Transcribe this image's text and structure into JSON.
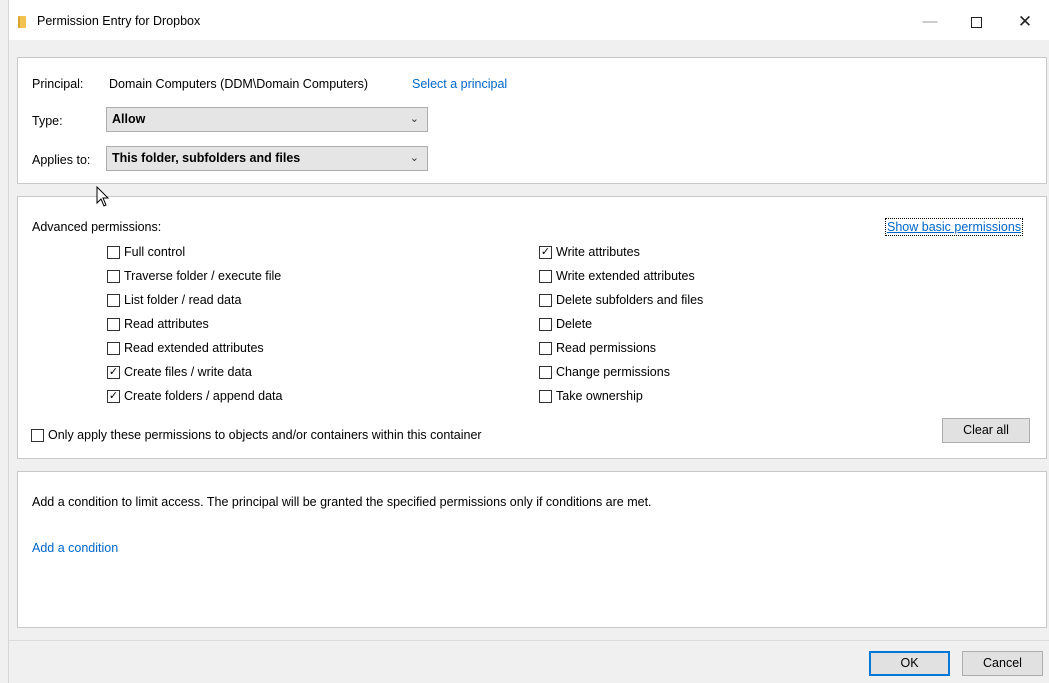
{
  "window": {
    "title": "Permission Entry for Dropbox",
    "minimize_glyph": "—",
    "close_glyph": "✕"
  },
  "principal": {
    "label": "Principal:",
    "value": "Domain Computers (DDM\\Domain Computers)",
    "select_link": "Select a principal"
  },
  "type": {
    "label": "Type:",
    "value": "Allow"
  },
  "applies_to": {
    "label": "Applies to:",
    "value": "This folder, subfolders and files"
  },
  "advanced": {
    "heading": "Advanced permissions:",
    "show_basic_link": "Show basic permissions",
    "left_column": [
      {
        "label": "Full control",
        "checked": false
      },
      {
        "label": "Traverse folder / execute file",
        "checked": false
      },
      {
        "label": "List folder / read data",
        "checked": false
      },
      {
        "label": "Read attributes",
        "checked": false
      },
      {
        "label": "Read extended attributes",
        "checked": false
      },
      {
        "label": "Create files / write data",
        "checked": true
      },
      {
        "label": "Create folders / append data",
        "checked": true
      }
    ],
    "right_column": [
      {
        "label": "Write attributes",
        "checked": true
      },
      {
        "label": "Write extended attributes",
        "checked": false
      },
      {
        "label": "Delete subfolders and files",
        "checked": false
      },
      {
        "label": "Delete",
        "checked": false
      },
      {
        "label": "Read permissions",
        "checked": false
      },
      {
        "label": "Change permissions",
        "checked": false
      },
      {
        "label": "Take ownership",
        "checked": false
      }
    ],
    "only_apply_label": "Only apply these permissions to objects and/or containers within this container",
    "only_apply_checked": false,
    "clear_all": "Clear all"
  },
  "condition": {
    "description": "Add a condition to limit access. The principal will be granted the specified permissions only if conditions are met.",
    "add_link": "Add a condition"
  },
  "footer": {
    "ok": "OK",
    "cancel": "Cancel"
  }
}
